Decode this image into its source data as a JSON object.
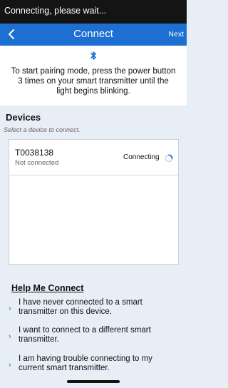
{
  "status_bar": {
    "text": "Connecting, please wait..."
  },
  "nav": {
    "back_icon": "chevron-left-icon",
    "title": "Connect",
    "next_label": "Next"
  },
  "intro": {
    "icon": "bluetooth-icon",
    "text": "To start pairing mode, press the power button 3 times on your smart transmitter until the light begins blinking."
  },
  "devices": {
    "title": "Devices",
    "hint": "Select a device to connect.",
    "items": [
      {
        "name": "T0038138",
        "status": "Not connected",
        "connection_state": "Connecting",
        "spinner_icon": "loading-spinner-icon"
      }
    ]
  },
  "help": {
    "title": "Help Me Connect",
    "items": [
      {
        "label": "I have never connected to a smart transmitter on this device."
      },
      {
        "label": "I want to connect to a different smart transmitter."
      },
      {
        "label": "I am having trouble connecting to my current smart transmitter."
      }
    ]
  },
  "colors": {
    "accent": "#1d6fd1",
    "background": "#e8eef6",
    "status_bar": "#141414"
  }
}
